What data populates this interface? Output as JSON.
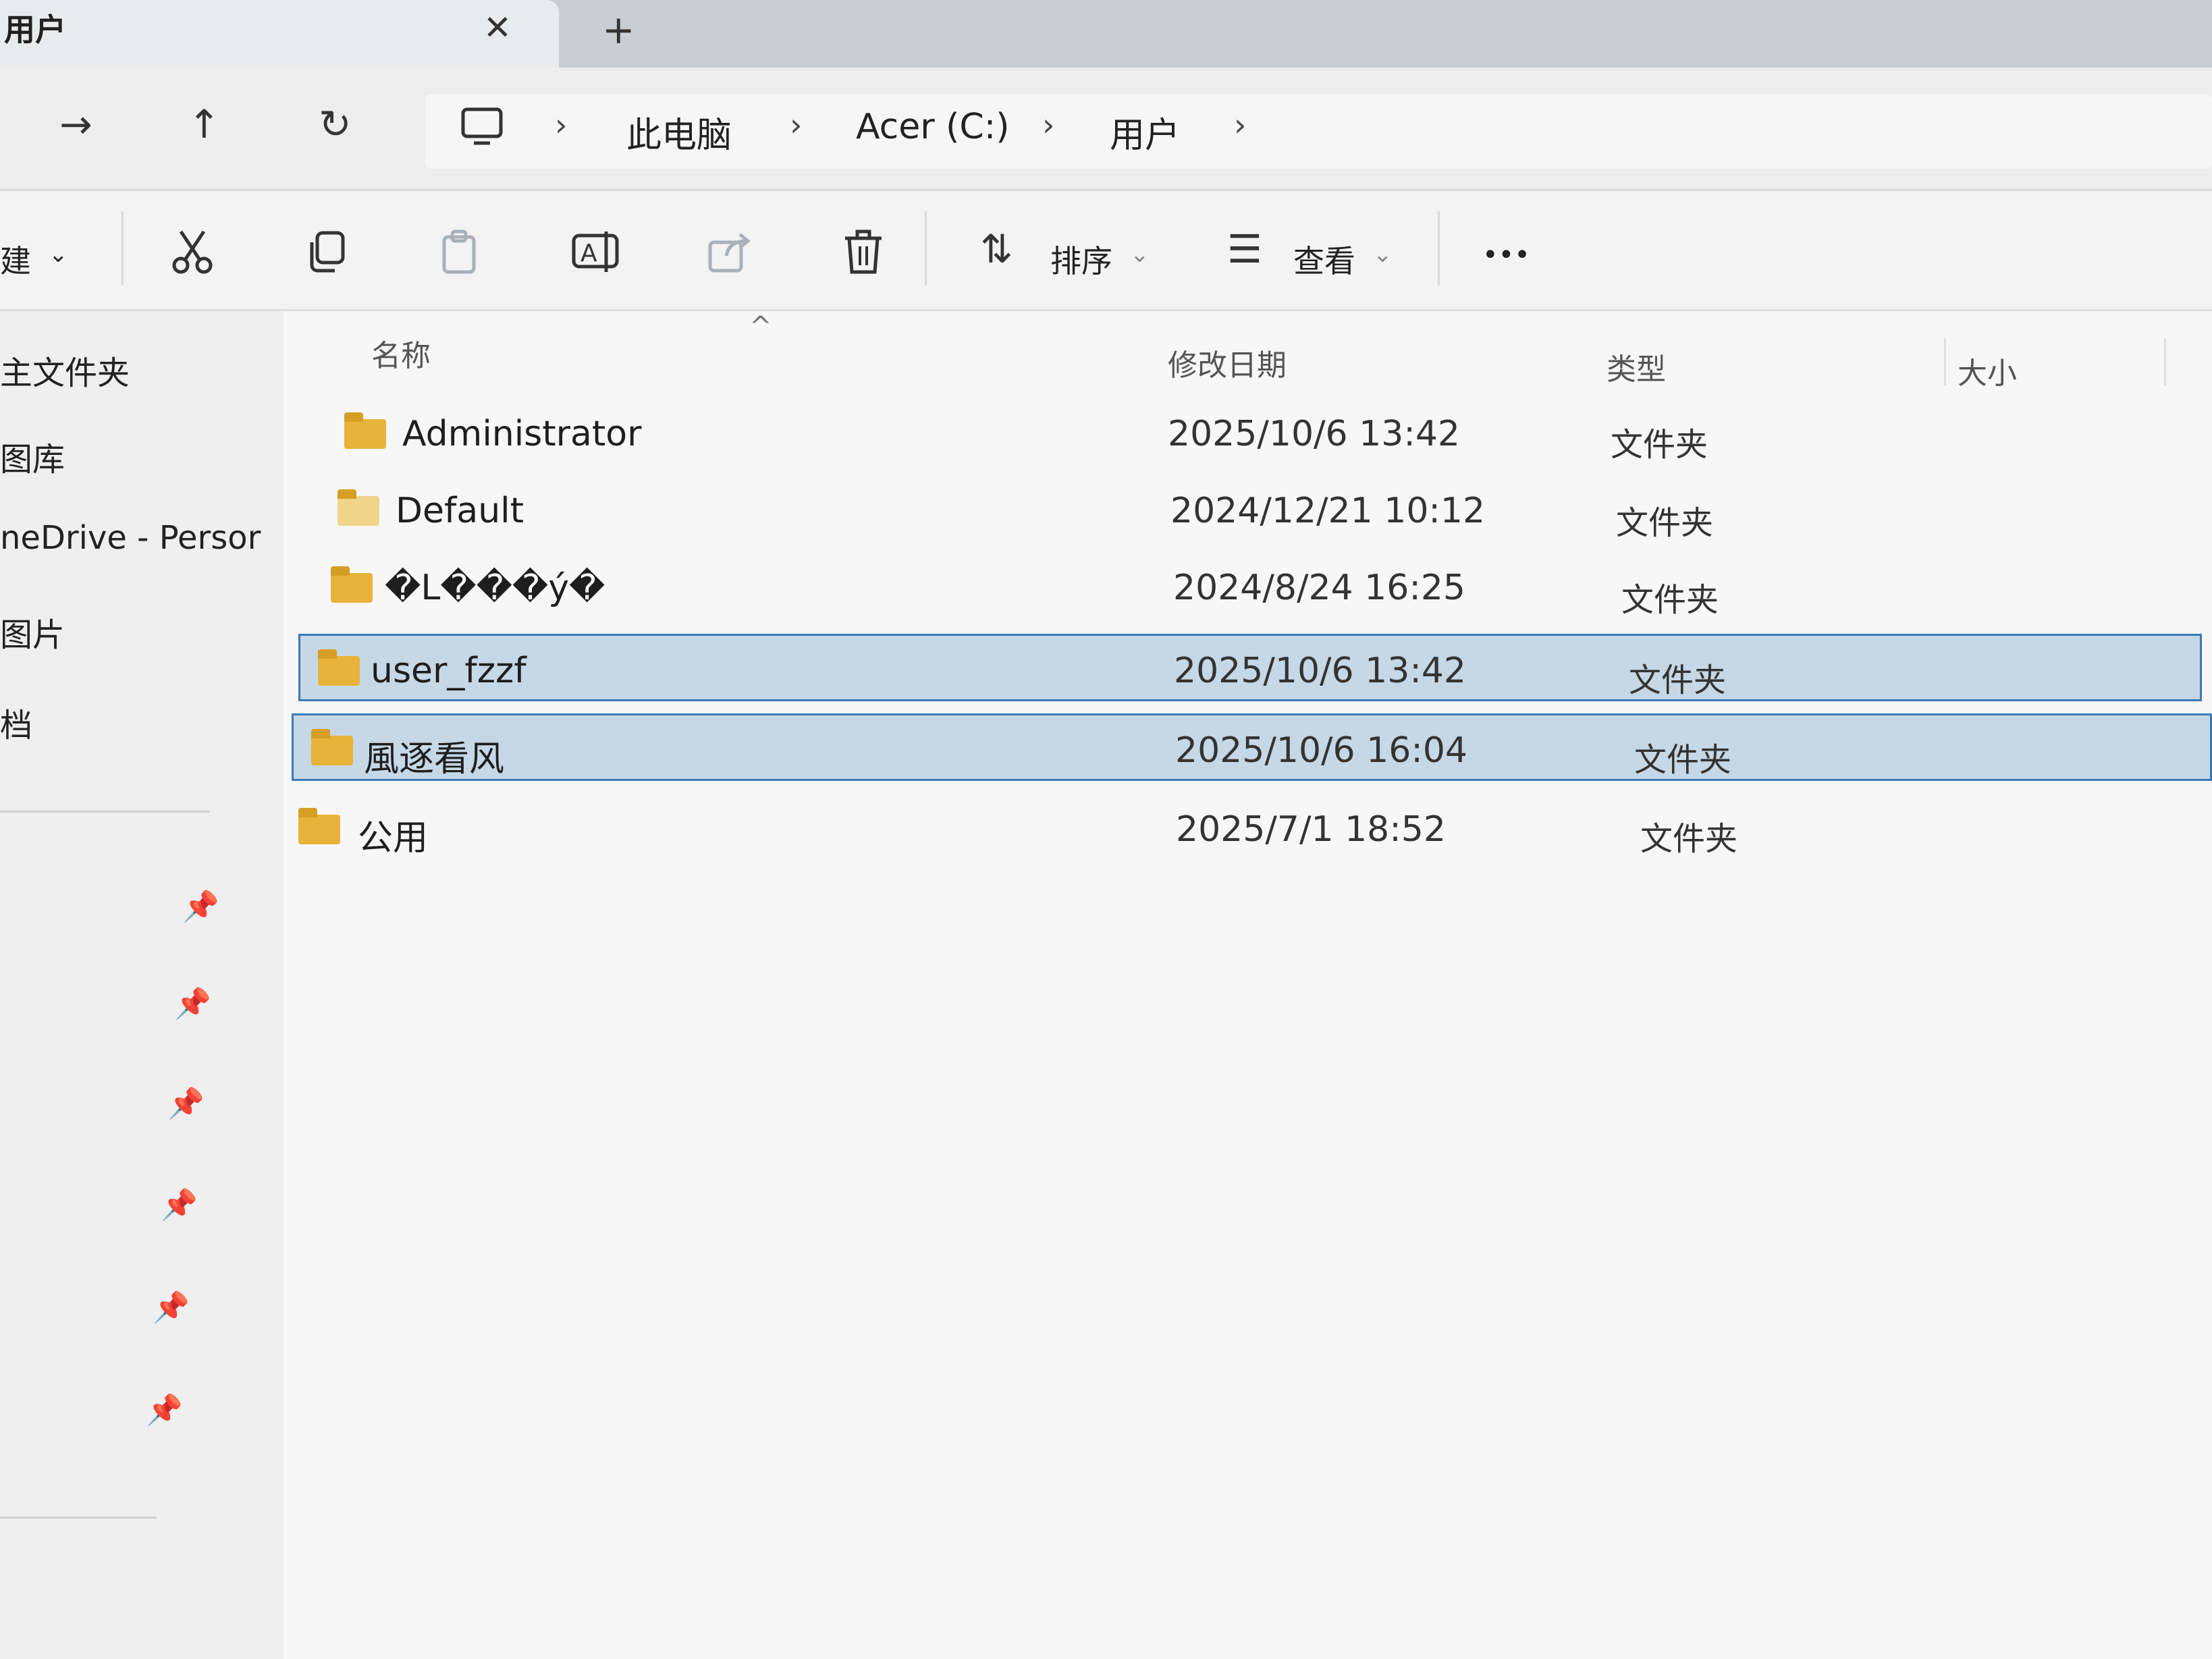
{
  "tab": {
    "title": "用户",
    "close_glyph": "✕",
    "new_glyph": "+"
  },
  "nav": {
    "forward": "→",
    "up": "↑",
    "refresh": "↻"
  },
  "breadcrumb": {
    "separator": "›",
    "items": [
      "此电脑",
      "Acer (C:)",
      "用户"
    ]
  },
  "commands": {
    "new_label": "建",
    "sort_label": "排序",
    "view_label": "查看",
    "more": "•••",
    "dropdown": "⌄"
  },
  "sidebar": {
    "items": [
      "主文件夹",
      "图库",
      "neDrive - Persor",
      "图片",
      "档"
    ]
  },
  "columns": {
    "name": "名称",
    "date": "修改日期",
    "type": "类型",
    "size": "大小"
  },
  "files": [
    {
      "name": "Administrator",
      "date": "2025/10/6 13:42",
      "type": "文件夹",
      "selected": false
    },
    {
      "name": "Default",
      "date": "2024/12/21 10:12",
      "type": "文件夹",
      "selected": false
    },
    {
      "name": "�L���ý�",
      "date": "2024/8/24 16:25",
      "type": "文件夹",
      "selected": false
    },
    {
      "name": "user_fzzf",
      "date": "2025/10/6 13:42",
      "type": "文件夹",
      "selected": true
    },
    {
      "name": "風逐看风",
      "date": "2025/10/6 16:04",
      "type": "文件夹",
      "selected": true
    },
    {
      "name": "公用",
      "date": "2025/7/1 18:52",
      "type": "文件夹",
      "selected": false
    }
  ],
  "colors": {
    "selection_bg": "#c6d7e6",
    "selection_border": "#3d79b8",
    "folder": "#e8b33a"
  }
}
